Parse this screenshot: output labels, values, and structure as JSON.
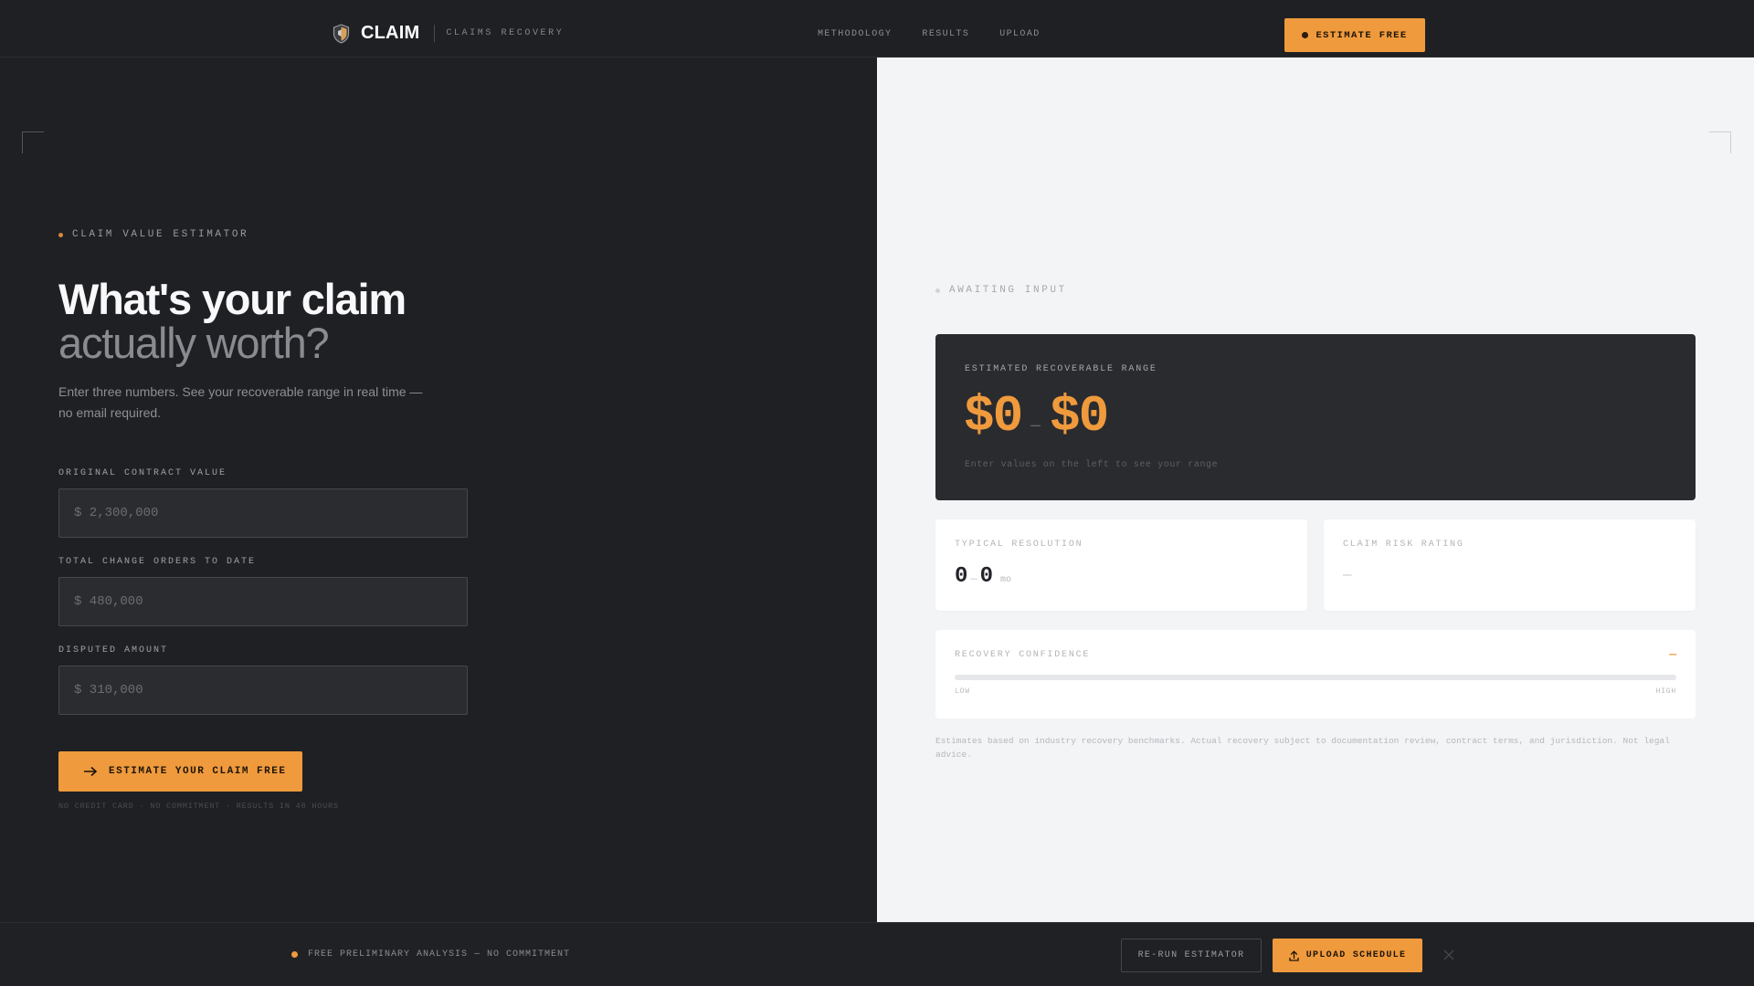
{
  "nav": {
    "brand_name": "CLAIM",
    "brand_sub": "CLAIMS RECOVERY",
    "links": [
      "METHODOLOGY",
      "RESULTS",
      "UPLOAD"
    ],
    "cta_label": "ESTIMATE FREE"
  },
  "estimator": {
    "eyebrow": "CLAIM VALUE ESTIMATOR",
    "title_line1": "What's your claim",
    "title_line2": "actually worth?",
    "subtitle": "Enter three numbers. See your recoverable range in real time — no email required.",
    "fields": [
      {
        "label": "ORIGINAL CONTRACT VALUE",
        "placeholder": "$ 2,300,000",
        "value": ""
      },
      {
        "label": "TOTAL CHANGE ORDERS TO DATE",
        "placeholder": "$ 480,000",
        "value": ""
      },
      {
        "label": "DISPUTED AMOUNT",
        "placeholder": "$ 310,000",
        "value": ""
      }
    ],
    "cta_label": "ESTIMATE YOUR CLAIM FREE",
    "fine_print": "NO CREDIT CARD · NO COMMITMENT · RESULTS IN 48 HOURS"
  },
  "results": {
    "status": "AWAITING INPUT",
    "range_label": "ESTIMATED RECOVERABLE RANGE",
    "range_low": "$0",
    "range_sep": "—",
    "range_high": "$0",
    "range_hint": "Enter values on the left to see your range",
    "typical_resolution": {
      "label": "TYPICAL RESOLUTION",
      "low": "0",
      "sep": "—",
      "high": "0",
      "unit": "mo"
    },
    "risk_rating": {
      "label": "CLAIM RISK RATING",
      "value": "—"
    },
    "confidence": {
      "label": "RECOVERY CONFIDENCE",
      "value": "—",
      "level": 0,
      "low_label": "LOW",
      "high_label": "HIGH"
    },
    "disclaimer": "Estimates based on industry recovery benchmarks. Actual recovery subject to documentation review, contract terms, and jurisdiction. Not legal advice."
  },
  "bottom_bar": {
    "notice": "FREE PRELIMINARY ANALYSIS — NO COMMITMENT",
    "rerun_label": "RE-RUN ESTIMATOR",
    "upload_label": "UPLOAD SCHEDULE"
  },
  "colors": {
    "accent": "#ef9a3d",
    "dark_bg": "#1f2024",
    "light_bg": "#f3f4f6"
  },
  "icons": {
    "brand": "shield-icon",
    "cta_arrow": "arrow-right-icon",
    "upload": "upload-icon",
    "close": "close-icon"
  }
}
